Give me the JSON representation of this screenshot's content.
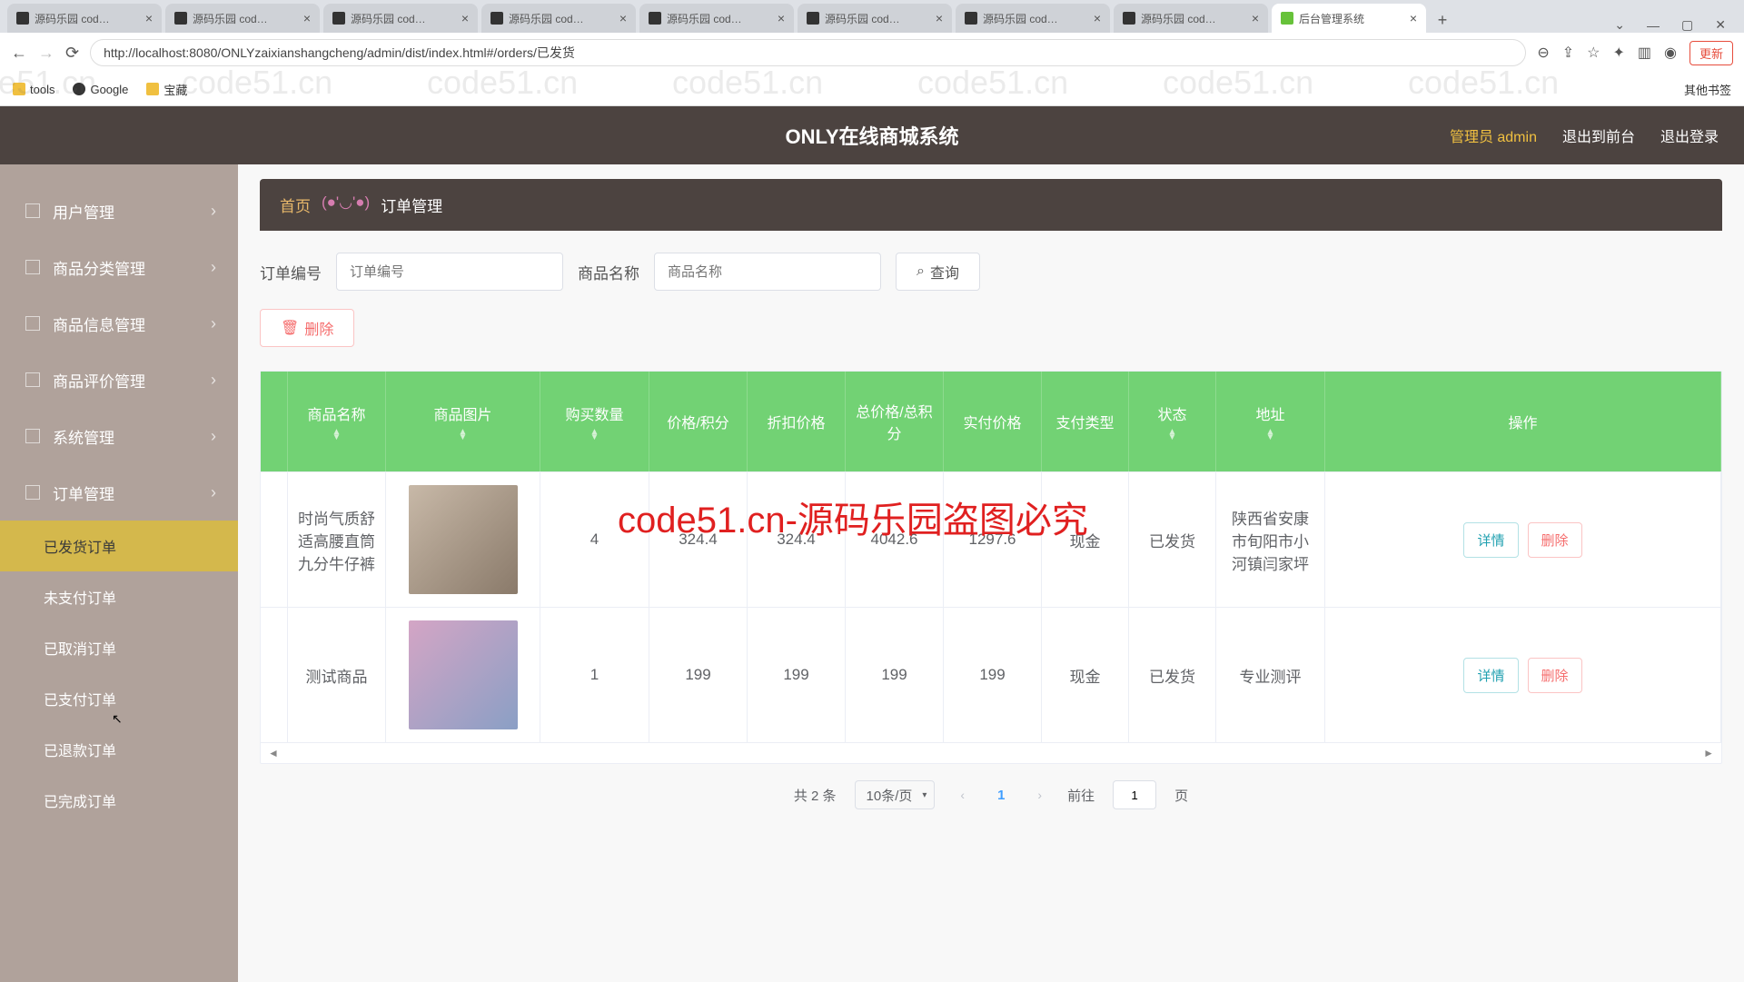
{
  "browser": {
    "tabs": [
      {
        "title": "源码乐园 cod…",
        "active": false
      },
      {
        "title": "源码乐园 cod…",
        "active": false
      },
      {
        "title": "源码乐园 cod…",
        "active": false
      },
      {
        "title": "源码乐园 cod…",
        "active": false
      },
      {
        "title": "源码乐园 cod…",
        "active": false
      },
      {
        "title": "源码乐园 cod…",
        "active": false
      },
      {
        "title": "源码乐园 cod…",
        "active": false
      },
      {
        "title": "源码乐园 cod…",
        "active": false
      },
      {
        "title": "后台管理系统",
        "active": true
      }
    ],
    "url": "http://localhost:8080/ONLYzaixianshangcheng/admin/dist/index.html#/orders/已发货",
    "update_label": "更新",
    "bookmarks": {
      "tools": "tools",
      "google": "Google",
      "baozang": "宝藏",
      "other": "其他书签"
    }
  },
  "header": {
    "title": "ONLY在线商城系统",
    "admin": "管理员 admin",
    "front": "退出到前台",
    "logout": "退出登录"
  },
  "breadcrumb": {
    "home": "首页",
    "sep": "(●'◡'●)",
    "current": "订单管理"
  },
  "sidebar": {
    "menu": [
      {
        "label": "用户管理"
      },
      {
        "label": "商品分类管理"
      },
      {
        "label": "商品信息管理"
      },
      {
        "label": "商品评价管理"
      },
      {
        "label": "系统管理"
      },
      {
        "label": "订单管理"
      }
    ],
    "submenu": [
      {
        "label": "已发货订单",
        "active": true
      },
      {
        "label": "未支付订单",
        "active": false
      },
      {
        "label": "已取消订单",
        "active": false
      },
      {
        "label": "已支付订单",
        "active": false
      },
      {
        "label": "已退款订单",
        "active": false
      },
      {
        "label": "已完成订单",
        "active": false
      }
    ]
  },
  "filter": {
    "order_label": "订单编号",
    "order_placeholder": "订单编号",
    "product_label": "商品名称",
    "product_placeholder": "商品名称",
    "search": "查询",
    "delete": "删除"
  },
  "table": {
    "headers": {
      "name": "商品名称",
      "img": "商品图片",
      "qty": "购买数量",
      "price": "价格/积分",
      "discount": "折扣价格",
      "total": "总价格/总积分",
      "actual": "实付价格",
      "paytype": "支付类型",
      "status": "状态",
      "addr": "地址",
      "op": "操作"
    },
    "rows": [
      {
        "id": "27",
        "name": "时尚气质舒适高腰直筒九分牛仔裤",
        "qty": "4",
        "price": "324.4",
        "discount": "324.4",
        "total": "4042.6",
        "actual": "1297.6",
        "paytype": "现金",
        "status": "已发货",
        "addr": "陕西省安康市旬阳市小河镇闫家坪"
      },
      {
        "id": "891",
        "name": "测试商品",
        "qty": "1",
        "price": "199",
        "discount": "199",
        "total": "199",
        "actual": "199",
        "paytype": "现金",
        "status": "已发货",
        "addr": "专业测评"
      }
    ],
    "op_detail": "详情",
    "op_delete": "删除"
  },
  "pagination": {
    "total": "共 2 条",
    "page_size": "10条/页",
    "current": "1",
    "goto_label": "前往",
    "goto_value": "1",
    "page_suffix": "页"
  },
  "watermark_text": "code51.cn",
  "overlay": "code51.cn-源码乐园盗图必究"
}
